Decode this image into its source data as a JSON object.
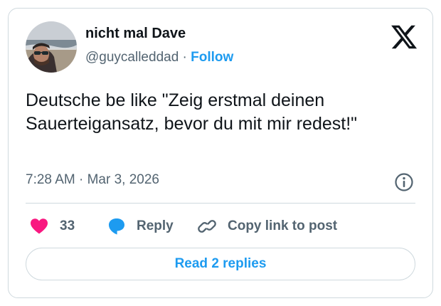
{
  "tweet": {
    "author": {
      "display_name": "nicht mal Dave",
      "handle": "@guycalleddad",
      "separator": "·",
      "follow_label": "Follow"
    },
    "text": "Deutsche be like \"Zeig erstmal deinen Sauerteigansatz, bevor du mit mir redest!\"",
    "time": "7:28 AM",
    "date_separator": "·",
    "date": "Mar 3, 2026",
    "actions": {
      "like_count": "33",
      "reply_label": "Reply",
      "copy_link_label": "Copy link to post"
    },
    "read_replies_label": "Read 2 replies"
  },
  "icons": {
    "brand": "x-logo-icon",
    "info": "info-icon",
    "like": "heart-icon",
    "reply": "speech-bubble-icon",
    "copy": "link-icon"
  },
  "colors": {
    "accent": "#1d9bf0",
    "like": "#f91880",
    "text": "#0f1419",
    "muted": "#536471",
    "border": "#cfd9de"
  }
}
